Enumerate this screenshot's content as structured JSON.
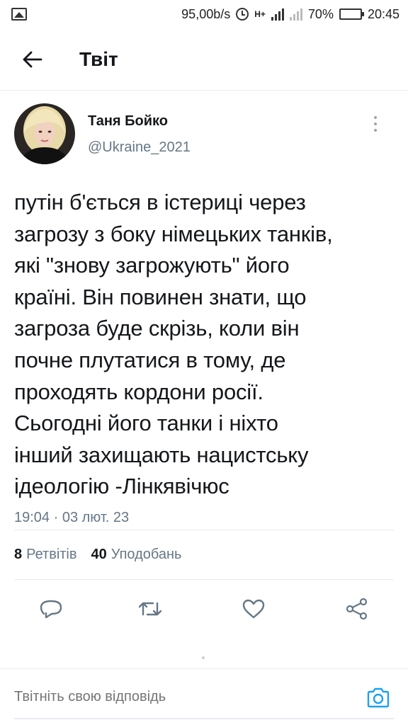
{
  "status_bar": {
    "speed": "95,00b/s",
    "network_label": "H+",
    "battery_percent": "70%",
    "battery_level": 0.7,
    "time": "20:45",
    "icons": [
      "image-icon",
      "alarm-clock-icon",
      "signal-icon",
      "battery-icon"
    ]
  },
  "header": {
    "title": "Твіт",
    "back_icon": "arrow-left-icon"
  },
  "tweet": {
    "author_name": "Таня Бойко",
    "author_handle": "@Ukraine_2021",
    "text": "путін б'ється в істериці через\nзагрозу з боку німецьких танків,\nякі \"знову загрожують\" його\nкраїні. Він повинен знати, що\nзагроза буде скрізь, коли він\nпочне плутатися в тому, де\nпроходять кордони росії.\nСьогодні його танки і ніхто\nінший захищають нацистську\nідеологію -Лінкявічюс",
    "timestamp": "19:04 · 03 лют. 23"
  },
  "stats": {
    "retweets_count": "8",
    "retweets_label": "Ретвітів",
    "likes_count": "40",
    "likes_label": "Уподобань"
  },
  "actions": [
    "reply-icon",
    "retweet-icon",
    "like-icon",
    "share-icon"
  ],
  "reply": {
    "placeholder": "Твітніть свою відповідь",
    "camera_icon": "camera-icon"
  },
  "colors": {
    "text": "#14171a",
    "secondary": "#657786",
    "accent": "#1da1f2",
    "divider": "#e6ecf0",
    "battery": "#2bb34a"
  }
}
